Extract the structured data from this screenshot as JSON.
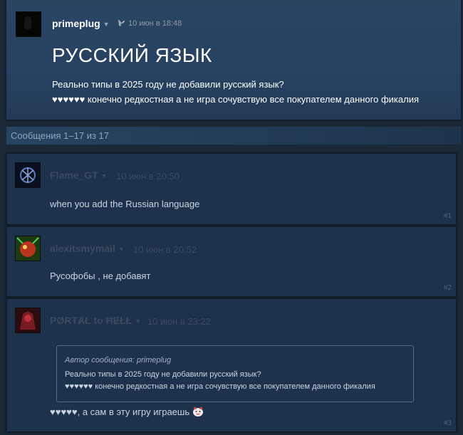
{
  "op": {
    "author": "primeplug",
    "date": "10 июн в 18:48",
    "title": "РУССКИЙ ЯЗЫК",
    "body_line1": "Реально типы в 2025 году не добавили русский язык?",
    "body_line2": "♥♥♥♥♥♥ конечно редкостная а не игра сочувствую все покупателем данного фикалия"
  },
  "count_text": "Сообщения 1–17 из 17",
  "comments": [
    {
      "author": "Flame_GT",
      "date": "10 июн в 20:50",
      "text": "when you add the Russian language",
      "num": "#1"
    },
    {
      "author": "alexitsmymail",
      "date": "10 июн в 20:52",
      "text": "Русофобы , не добавят",
      "num": "#2"
    },
    {
      "author": "PØRŦȺŁ to ĦɆŁŁ",
      "date": "10 июн в 23:22",
      "quote_author": "Автор сообщения: primeplug",
      "quote_line1": "Реально типы в 2025 году не добавили русский язык?",
      "quote_line2": "♥♥♥♥♥♥ конечно редкостная а не игра сочувствую все покупателем данного фикалия",
      "text": "♥♥♥♥♥, а сам в эту игру играешь",
      "num": "#3"
    }
  ]
}
